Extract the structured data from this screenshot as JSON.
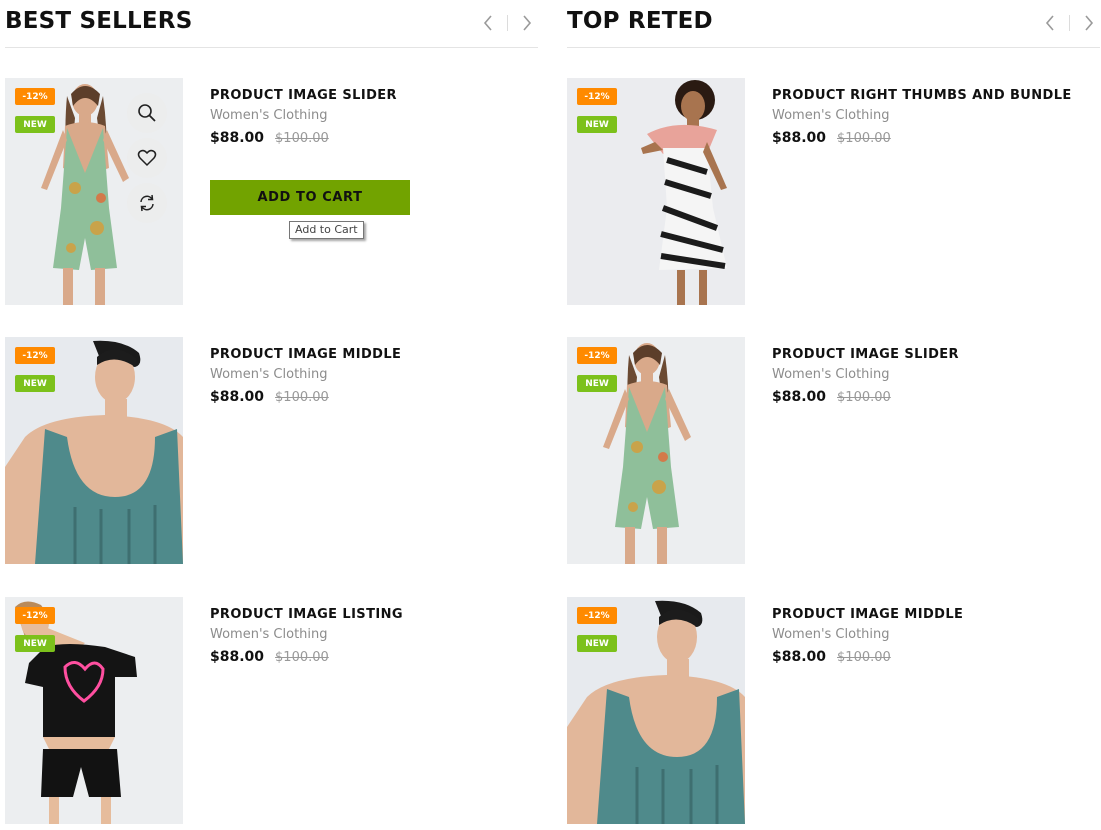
{
  "sections": {
    "best_sellers": {
      "title": "BEST SELLERS"
    },
    "top_rated": {
      "title": "TOP RETED"
    }
  },
  "colors": {
    "sale_badge": "#ff8a00",
    "new_badge": "#7cc11b",
    "add_to_cart": "#72a300",
    "category_text": "#8c8c8c",
    "old_price_text": "#999999"
  },
  "badges": {
    "sale": "-12%",
    "new": "NEW"
  },
  "best_sellers": [
    {
      "name": "PRODUCT IMAGE SLIDER",
      "category": "Women's Clothing",
      "price": "$88.00",
      "old_price": "$100.00",
      "image": "model-floral-romper"
    },
    {
      "name": "PRODUCT IMAGE MIDDLE",
      "category": "Women's Clothing",
      "price": "$88.00",
      "old_price": "$100.00",
      "image": "model-man-tank-top"
    },
    {
      "name": "PRODUCT IMAGE LISTING",
      "category": "Women's Clothing",
      "price": "$88.00",
      "old_price": "$100.00",
      "image": "model-black-tee-shorts"
    }
  ],
  "top_rated": [
    {
      "name": "PRODUCT RIGHT THUMBS AND BUNDLE",
      "category": "Women's Clothing",
      "price": "$88.00",
      "old_price": "$100.00",
      "image": "model-print-dress"
    },
    {
      "name": "PRODUCT IMAGE SLIDER",
      "category": "Women's Clothing",
      "price": "$88.00",
      "old_price": "$100.00",
      "image": "model-floral-romper"
    },
    {
      "name": "PRODUCT IMAGE MIDDLE",
      "category": "Women's Clothing",
      "price": "$88.00",
      "old_price": "$100.00",
      "image": "model-man-tank-top"
    }
  ],
  "hover_actions": {
    "add_to_cart_label": "ADD TO CART",
    "tooltip": "Add to Cart",
    "icons": [
      "search-icon",
      "heart-icon",
      "compare-icon"
    ]
  }
}
